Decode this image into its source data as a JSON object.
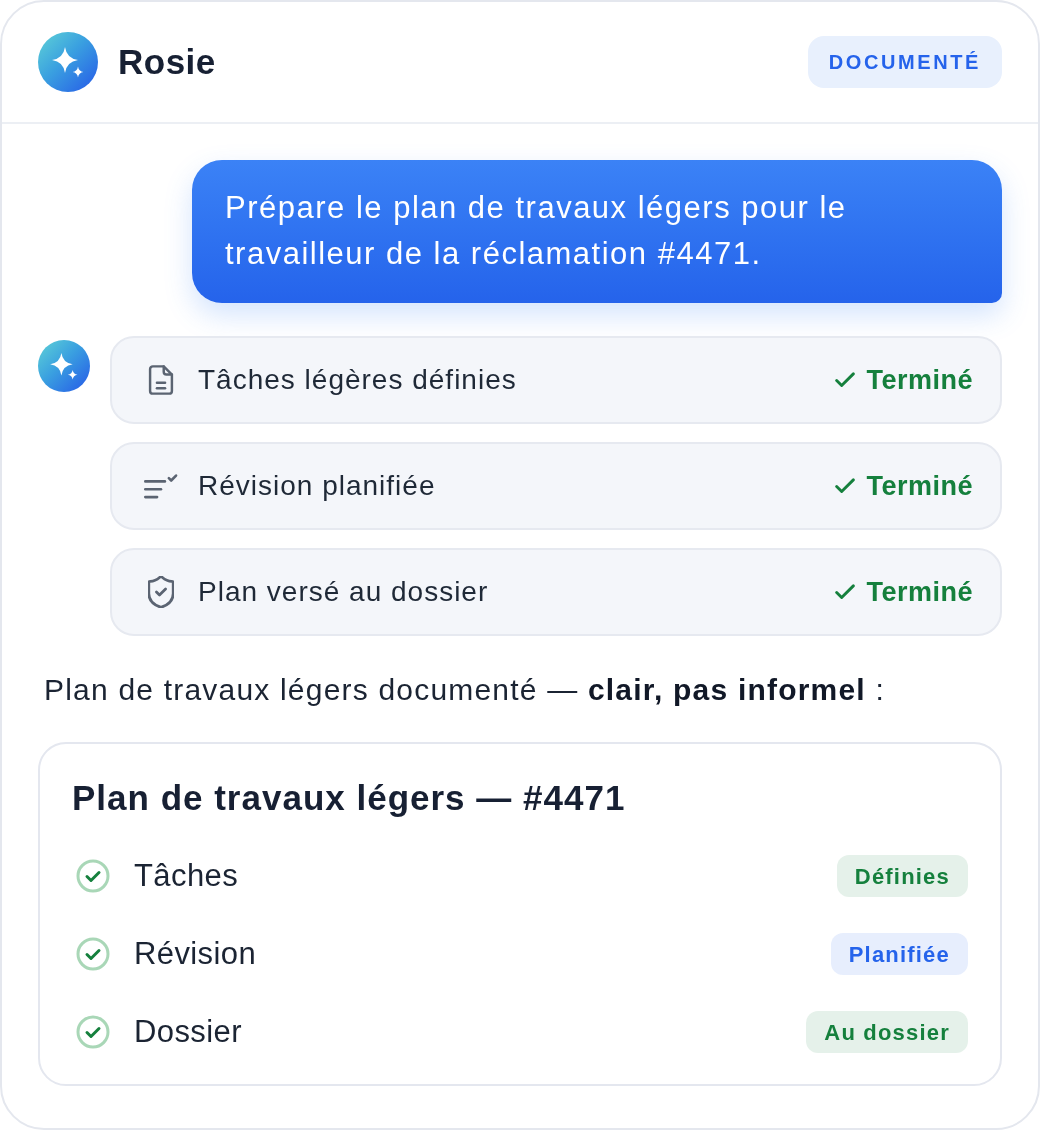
{
  "header": {
    "name": "Rosie",
    "badge": "DOCUMENTÉ"
  },
  "request": {
    "text": "Prépare le plan de travaux légers pour le travailleur de la réclamation #4471."
  },
  "steps": [
    {
      "kind": "document",
      "label": "Tâches légères définies",
      "status": "Terminé",
      "done": true
    },
    {
      "kind": "list-check",
      "label": "Révision planifiée",
      "status": "Terminé",
      "done": true
    },
    {
      "kind": "shield-check",
      "label": "Plan versé au dossier",
      "status": "Terminé",
      "done": true
    }
  ],
  "summary": "Plan de travaux légers documenté — **clair, pas informel** :",
  "plan": {
    "title": "Plan de travaux légers — #4471",
    "items": [
      {
        "label": "Tâches",
        "checked": true,
        "tag": "Définies",
        "color": "#15803d"
      },
      {
        "label": "Révision",
        "checked": true,
        "tag": "Planifiée",
        "color": "#2563eb"
      },
      {
        "label": "Dossier",
        "checked": true,
        "tag": "Au dossier",
        "color": "#15803d"
      }
    ]
  }
}
